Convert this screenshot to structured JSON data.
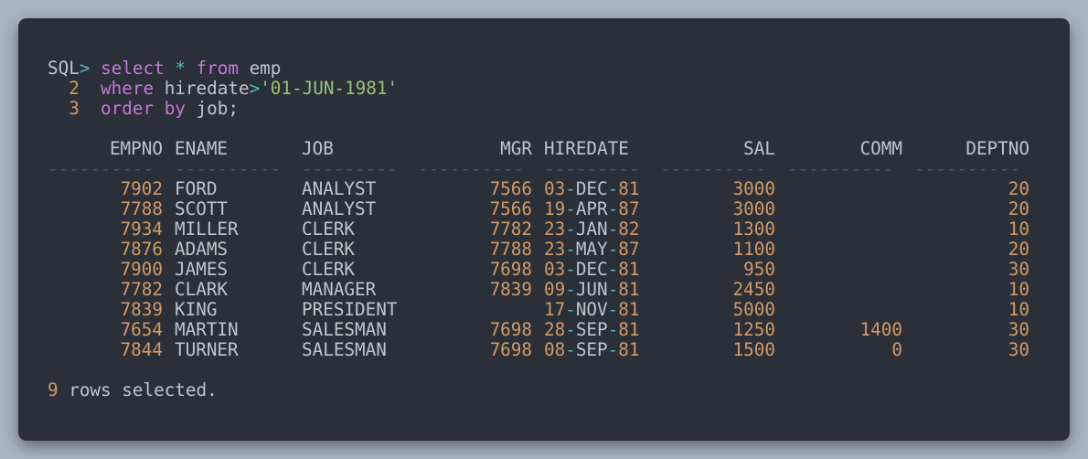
{
  "terminal": {
    "prompt": "SQL",
    "prompt_sym": ">",
    "query": [
      {
        "kw": "select",
        "op": "*",
        "kw2": "from",
        "rest": "emp"
      },
      {
        "num": "2",
        "kw": "where",
        "col": "hiredate",
        "op": ">",
        "str": "'01-JUN-1981'"
      },
      {
        "num": "3",
        "kw": "order",
        "kw2": "by",
        "rest": "job;"
      }
    ],
    "headers": [
      "EMPNO",
      "ENAME",
      "JOB",
      "MGR",
      "HIREDATE",
      "SAL",
      "COMM",
      "DEPTNO"
    ],
    "separators": [
      "----------",
      "----------",
      "---------",
      "----------",
      "---------",
      "----------",
      "----------",
      "----------"
    ],
    "rows": [
      {
        "empno": "7902",
        "ename": "FORD",
        "job": "ANALYST",
        "mgr": "7566",
        "day": "03",
        "mon": "DEC",
        "yr": "81",
        "sal": "3000",
        "comm": "",
        "deptno": "20"
      },
      {
        "empno": "7788",
        "ename": "SCOTT",
        "job": "ANALYST",
        "mgr": "7566",
        "day": "19",
        "mon": "APR",
        "yr": "87",
        "sal": "3000",
        "comm": "",
        "deptno": "20"
      },
      {
        "empno": "7934",
        "ename": "MILLER",
        "job": "CLERK",
        "mgr": "7782",
        "day": "23",
        "mon": "JAN",
        "yr": "82",
        "sal": "1300",
        "comm": "",
        "deptno": "10"
      },
      {
        "empno": "7876",
        "ename": "ADAMS",
        "job": "CLERK",
        "mgr": "7788",
        "day": "23",
        "mon": "MAY",
        "yr": "87",
        "sal": "1100",
        "comm": "",
        "deptno": "20"
      },
      {
        "empno": "7900",
        "ename": "JAMES",
        "job": "CLERK",
        "mgr": "7698",
        "day": "03",
        "mon": "DEC",
        "yr": "81",
        "sal": "950",
        "comm": "",
        "deptno": "30"
      },
      {
        "empno": "7782",
        "ename": "CLARK",
        "job": "MANAGER",
        "mgr": "7839",
        "day": "09",
        "mon": "JUN",
        "yr": "81",
        "sal": "2450",
        "comm": "",
        "deptno": "10"
      },
      {
        "empno": "7839",
        "ename": "KING",
        "job": "PRESIDENT",
        "mgr": "",
        "day": "17",
        "mon": "NOV",
        "yr": "81",
        "sal": "5000",
        "comm": "",
        "deptno": "10"
      },
      {
        "empno": "7654",
        "ename": "MARTIN",
        "job": "SALESMAN",
        "mgr": "7698",
        "day": "28",
        "mon": "SEP",
        "yr": "81",
        "sal": "1250",
        "comm": "1400",
        "deptno": "30"
      },
      {
        "empno": "7844",
        "ename": "TURNER",
        "job": "SALESMAN",
        "mgr": "7698",
        "day": "08",
        "mon": "SEP",
        "yr": "81",
        "sal": "1500",
        "comm": "0",
        "deptno": "30"
      }
    ],
    "footer": {
      "count": "9",
      "text": "rows selected."
    },
    "colors": {
      "background": "#2b2f37",
      "text": "#c0c4cb",
      "number": "#d19a66",
      "keyword": "#c678dd",
      "operator": "#56b6c2",
      "string": "#98c379"
    }
  }
}
